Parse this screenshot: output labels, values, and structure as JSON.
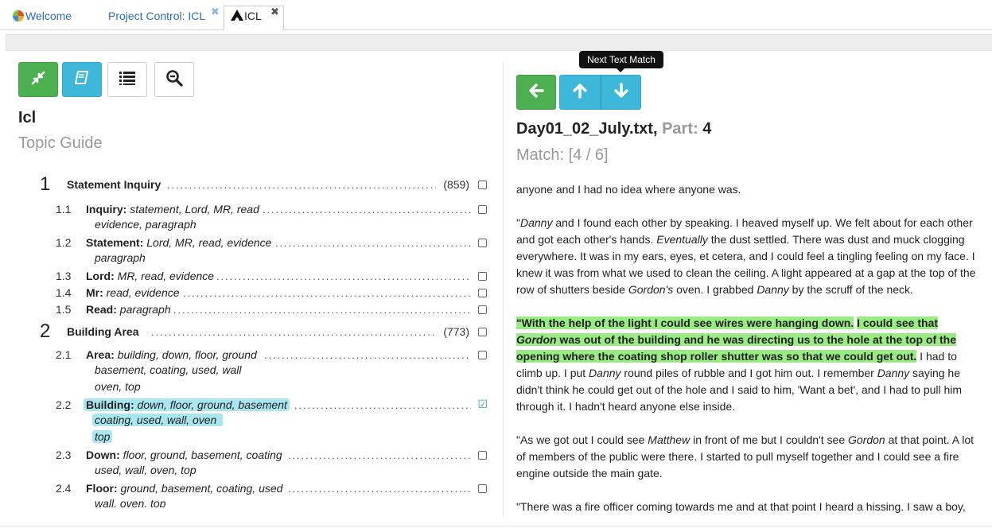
{
  "tabs": [
    {
      "label": "Welcome",
      "icon": "app-logo-icon"
    },
    {
      "label": "Project Control: ICL",
      "close": "✖"
    },
    {
      "label": "ICL",
      "icon": "hub-icon",
      "close": "✖",
      "active": true
    }
  ],
  "left": {
    "title": "Icl",
    "subtitle": "Topic Guide",
    "toolbar": [
      "collapse-icon",
      "book-icon",
      "list-icon",
      "zoom-out-icon"
    ]
  },
  "tree": [
    {
      "num": "1",
      "label": "Statement Inquiry",
      "count": "(859)"
    },
    {
      "num": "1.1",
      "label": "Inquiry:",
      "terms": "statement, Lord, MR, read",
      "cont": [
        "evidence, paragraph"
      ]
    },
    {
      "num": "1.2",
      "label": "Statement:",
      "terms": "Lord, MR, read, evidence",
      "cont": [
        "paragraph"
      ]
    },
    {
      "num": "1.3",
      "label": "Lord:",
      "terms": "MR, read, evidence"
    },
    {
      "num": "1.4",
      "label": "Mr:",
      "terms": "read, evidence"
    },
    {
      "num": "1.5",
      "label": "Read:",
      "terms": "paragraph"
    },
    {
      "num": "2",
      "label": "Building Area",
      "count": "(773)"
    },
    {
      "num": "2.1",
      "label": "Area:",
      "terms": "building, down, floor, ground",
      "cont": [
        "basement, coating, used, wall",
        "oven, top"
      ]
    },
    {
      "num": "2.2",
      "label": "Building:",
      "terms": "down, floor, ground, basement",
      "cont": [
        "coating, used, wall, oven",
        "top"
      ],
      "selected": true
    },
    {
      "num": "2.3",
      "label": "Down:",
      "terms": "floor, ground, basement, coating",
      "cont": [
        "used, wall, oven, top"
      ]
    },
    {
      "num": "2.4",
      "label": "Floor:",
      "terms": "ground, basement, coating, used",
      "cont": [
        "wall, oven, top"
      ]
    }
  ],
  "right": {
    "toolbar": [
      "back-arrow-icon",
      "arrow-up-icon",
      "arrow-down-icon"
    ],
    "tooltip": "Next Text Match",
    "file": "Day01_02_July.txt,",
    "part_label": "Part:",
    "part_value": "4",
    "match": "Match: [4 / 6]"
  },
  "doc": {
    "p1": "anyone and I had no idea where anyone was.",
    "p2": [
      {
        "t": "\"",
        "s": ""
      },
      {
        "t": "Danny",
        "s": "i"
      },
      {
        "t": " and I found each other by speaking. I heaved myself up. We felt about for each other and got each other's hands. ",
        "s": ""
      },
      {
        "t": "Eventually",
        "s": "i"
      },
      {
        "t": " the dust settled. There was dust and muck clogging everywhere. It was in my ears, eyes, et cetera, and I could feel a tingling feeling on my face. I knew it was from what we used to clean the ceiling. A light appeared at a gap at the top of the row of shutters beside ",
        "s": ""
      },
      {
        "t": "Gordon's",
        "s": "i"
      },
      {
        "t": " oven. I grabbed ",
        "s": ""
      },
      {
        "t": "Danny",
        "s": "i"
      },
      {
        "t": " by the scruff of the neck.",
        "s": ""
      }
    ],
    "p3": [
      {
        "t": "\"With the help of the light I could see wires were hanging down.",
        "s": "h"
      },
      {
        "t": " ",
        "s": ""
      },
      {
        "t": "I could see that ",
        "s": "h"
      },
      {
        "t": "Gordon",
        "s": "hi"
      },
      {
        "t": " was out of the building and he was directing us to the hole at the top of the opening where the coating shop roller shutter was so that we could get out.",
        "s": "h"
      },
      {
        "t": " I had to climb up. I put ",
        "s": ""
      },
      {
        "t": "Danny",
        "s": "i"
      },
      {
        "t": " round piles of rubble and I got him out. I remember ",
        "s": ""
      },
      {
        "t": "Danny",
        "s": "i"
      },
      {
        "t": " saying he didn't think he could get out of the hole and I said to him, 'Want a bet', and I had to pull him through it. I hadn't heard anyone else inside.",
        "s": ""
      }
    ],
    "p4": [
      {
        "t": "\"As we got out I could see ",
        "s": ""
      },
      {
        "t": "Matthew",
        "s": "i"
      },
      {
        "t": " in front of me but I couldn't see ",
        "s": ""
      },
      {
        "t": "Gordon",
        "s": "i"
      },
      {
        "t": " at that point. A lot of members of the public were there. I started to pull myself together and I could see a fire engine outside the main gate.",
        "s": ""
      }
    ],
    "p5": "\"There was a fire officer coming towards me and at that point I heard a hissing. I saw a boy,"
  }
}
